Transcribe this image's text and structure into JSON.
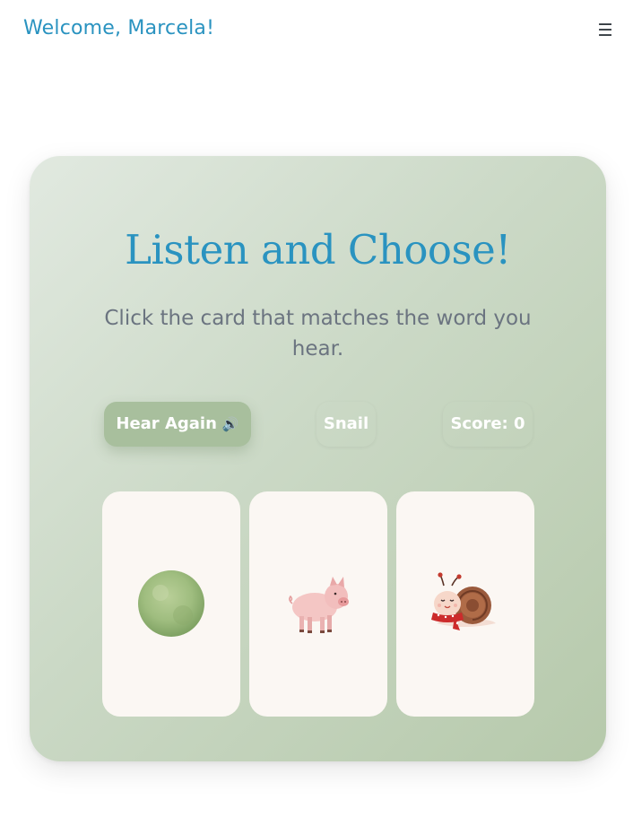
{
  "header": {
    "welcome": "Welcome, Marcela!",
    "menu_icon": "☰"
  },
  "game": {
    "title": "Listen and Choose!",
    "instructions": "Click the card that matches the word you hear.",
    "hear_again_label": "Hear Again",
    "speaker_icon": "🔊",
    "current_word": "Snail",
    "score_label": "Score: 0",
    "cards": [
      {
        "icon": "green-circle-icon"
      },
      {
        "icon": "pig-icon"
      },
      {
        "icon": "snail-icon"
      }
    ]
  },
  "colors": {
    "accent": "#2a93c0",
    "button": "#a8bf9d",
    "card": "#fbf7f3",
    "panel_start": "#e1e9e0",
    "panel_end": "#b6c9ab"
  }
}
